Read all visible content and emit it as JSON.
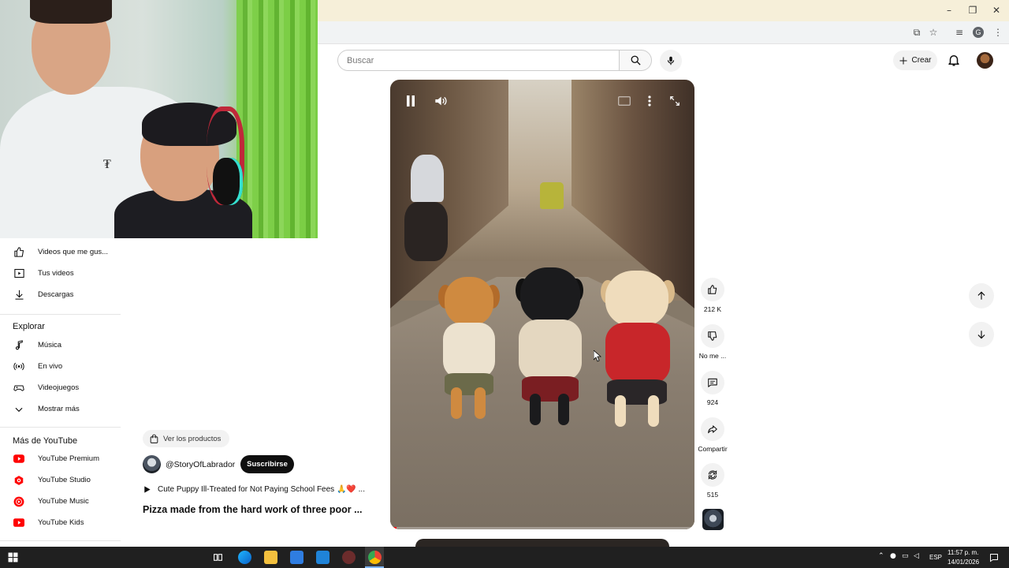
{
  "search": {
    "placeholder": "Buscar"
  },
  "header": {
    "create_label": "Crear"
  },
  "sidebar": {
    "items_top": [
      {
        "label": "Videos que me gus...",
        "icon": "thumb-up-icon"
      },
      {
        "label": "Tus videos",
        "icon": "play-square-icon"
      },
      {
        "label": "Descargas",
        "icon": "download-icon"
      }
    ],
    "explore_heading": "Explorar",
    "explore_items": [
      {
        "label": "Música",
        "icon": "music-note-icon"
      },
      {
        "label": "En vivo",
        "icon": "live-icon"
      },
      {
        "label": "Videojuegos",
        "icon": "gamepad-icon"
      },
      {
        "label": "Mostrar más",
        "icon": "chevron-down-icon"
      }
    ],
    "more_heading": "Más de YouTube",
    "more_items": [
      {
        "label": "YouTube Premium",
        "icon": "youtube-premium-icon"
      },
      {
        "label": "YouTube Studio",
        "icon": "youtube-studio-icon"
      },
      {
        "label": "YouTube Music",
        "icon": "youtube-music-icon"
      },
      {
        "label": "YouTube Kids",
        "icon": "youtube-kids-icon"
      }
    ]
  },
  "video": {
    "products_label": "Ver los productos",
    "channel": "@StoryOfLabrador",
    "subscribe_label": "Suscribirse",
    "playlist_title": "Cute Puppy Ill-Treated for Not Paying School Fees 🙏❤️ ...",
    "title": "Pizza made from the hard work of three poor ...",
    "progress": 0.02
  },
  "actions": {
    "likes": "212 K",
    "dislike_label": "No me ...",
    "comments": "924",
    "share_label": "Compartir",
    "remix_count": "515"
  },
  "taskbar": {
    "language": "ESP",
    "time": "11:57 p. m.",
    "date": "14/01/2026"
  },
  "colors": {
    "youtube_red": "#ff0000",
    "subscribe_bg": "#0f0f0f",
    "chip_bg": "#f2f2f2",
    "taskbar_bg": "#202020"
  }
}
